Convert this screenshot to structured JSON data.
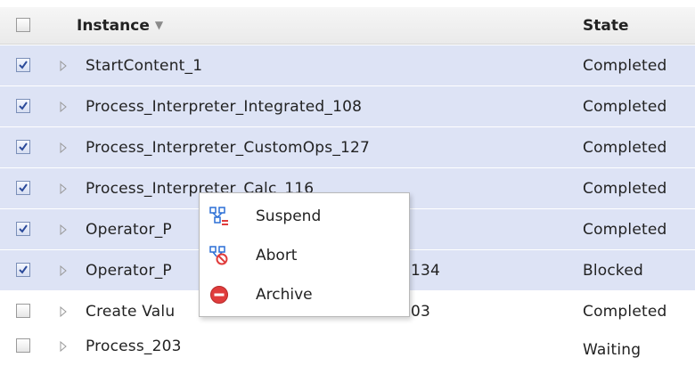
{
  "header": {
    "instance_label": "Instance",
    "state_label": "State",
    "sort_glyph": "▼"
  },
  "rows": [
    {
      "instance": "StartContent_1",
      "state": "Completed",
      "checked": true
    },
    {
      "instance": "Process_Interpreter_Integrated_108",
      "state": "Completed",
      "checked": true
    },
    {
      "instance": "Process_Interpreter_CustomOps_127",
      "state": "Completed",
      "checked": true
    },
    {
      "instance": "Process_Interpreter_Calc_116",
      "state": "Completed",
      "checked": true
    },
    {
      "instance": "Operator_P",
      "state": "Completed",
      "checked": true
    },
    {
      "instance": "Operator_P",
      "instance_tail": "134",
      "state": "Blocked",
      "checked": true
    },
    {
      "instance": "Create Valu",
      "instance_tail": "03",
      "state": "Completed",
      "checked": false
    },
    {
      "instance": "Process_203",
      "state": "Waiting",
      "checked": false
    }
  ],
  "context_menu": {
    "items": [
      {
        "label": "Suspend",
        "icon": "suspend-icon"
      },
      {
        "label": "Abort",
        "icon": "abort-icon"
      },
      {
        "label": "Archive",
        "icon": "archive-icon"
      }
    ]
  },
  "colors": {
    "selected_row": "#dde3f5",
    "archive_red": "#e03c3c",
    "icon_blue": "#2b6fd6"
  }
}
